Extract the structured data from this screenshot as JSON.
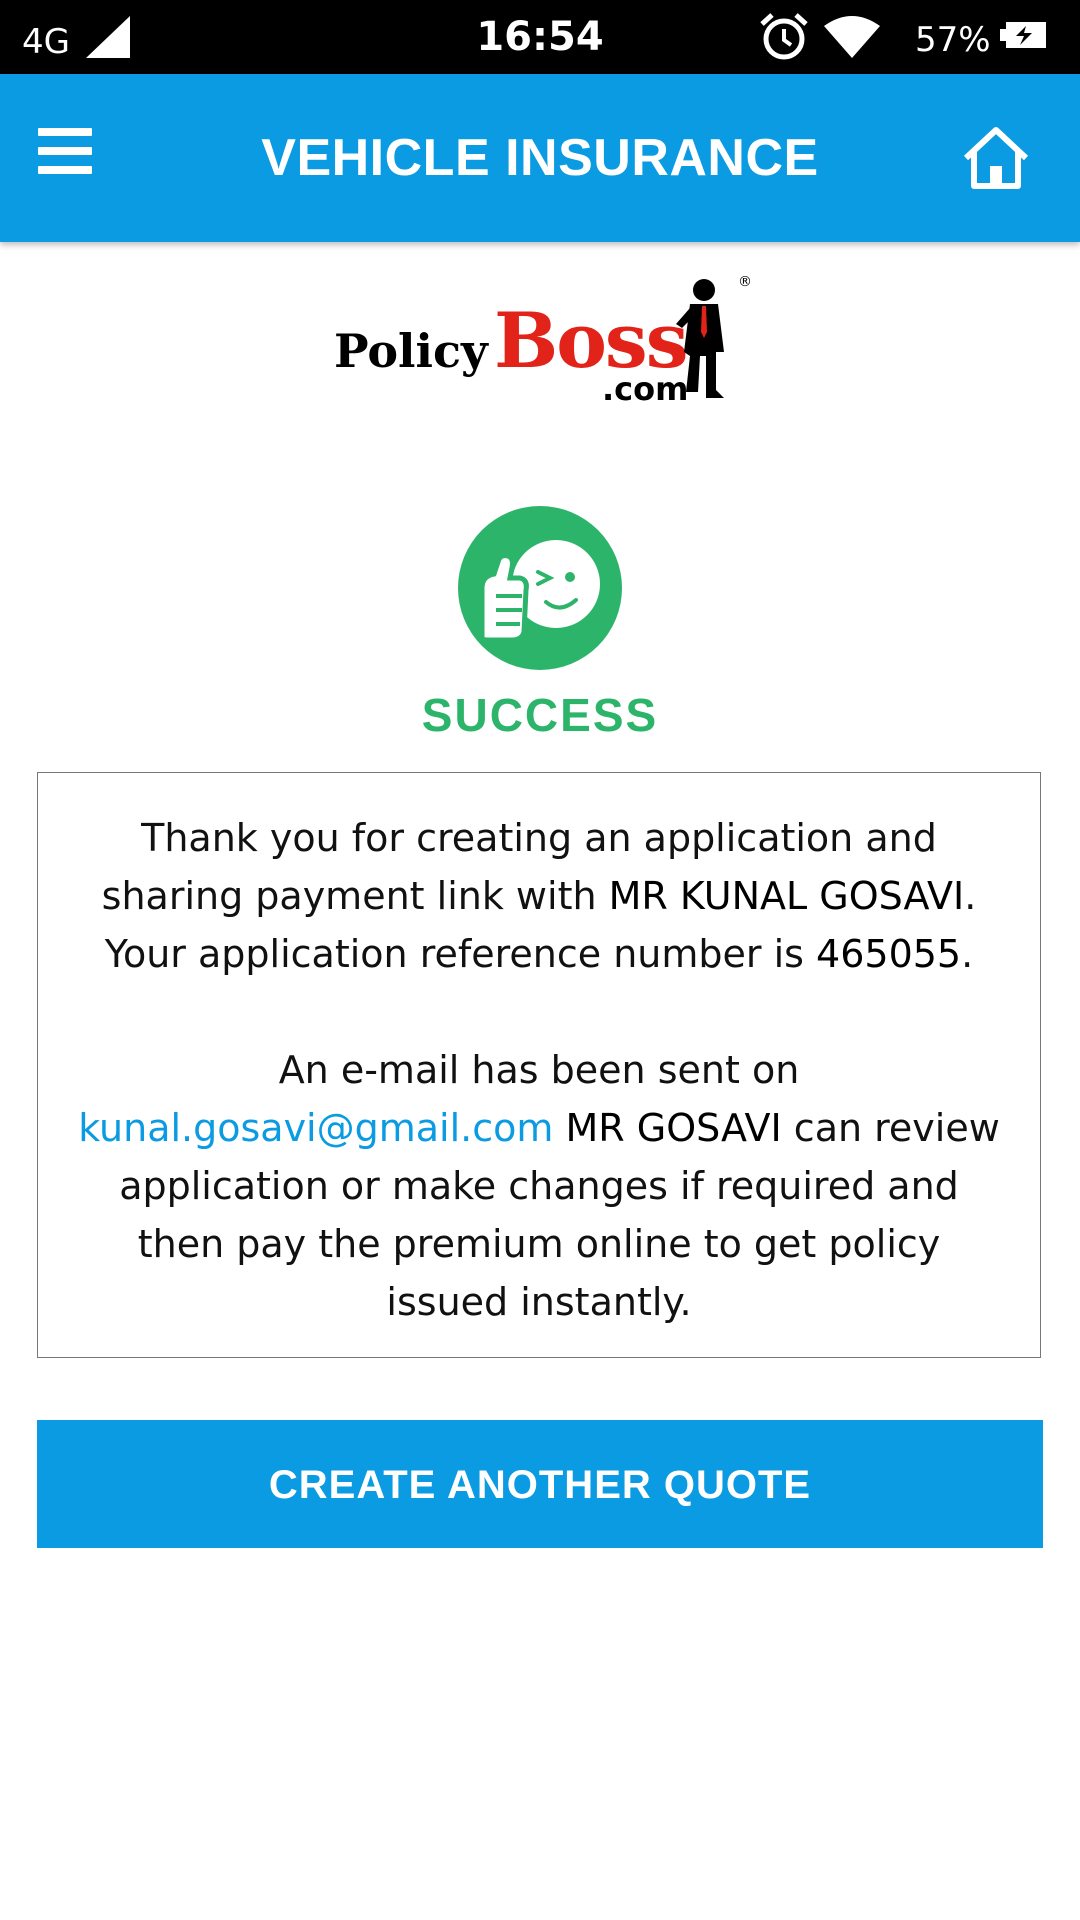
{
  "status_bar": {
    "network": "4G",
    "time": "16:54",
    "battery_percent": "57%",
    "icons": [
      "signal-icon",
      "alarm-icon",
      "wifi-icon",
      "battery-charging-icon"
    ]
  },
  "app_bar": {
    "title": "VEHICLE INSURANCE",
    "menu_icon": "hamburger-menu-icon",
    "home_icon": "home-icon"
  },
  "logo": {
    "policy": "Policy",
    "boss": "Boss",
    "com": ".com",
    "registered": "®"
  },
  "success": {
    "icon": "thumbs-up-wink-icon",
    "title": "SUCCESS"
  },
  "message": {
    "p1_part1": "Thank you for creating an application and sharing payment link with ",
    "customer_name": "MR KUNAL GOSAVI",
    "p1_part2": ". Your application reference number is ",
    "reference_number": "465055",
    "p1_part3": ".",
    "p2_part1": "An e-mail has been sent on ",
    "email": "kunal.gosavi@gmail.com",
    "p2_name": "MR GOSAVI",
    "p2_part2": " can review application or make changes if required and then pay the premium online to get policy issued instantly."
  },
  "actions": {
    "create_another_quote": "CREATE ANOTHER QUOTE"
  },
  "colors": {
    "primary": "#0a9be2",
    "success": "#2db46b",
    "brand_red": "#e2231a"
  }
}
